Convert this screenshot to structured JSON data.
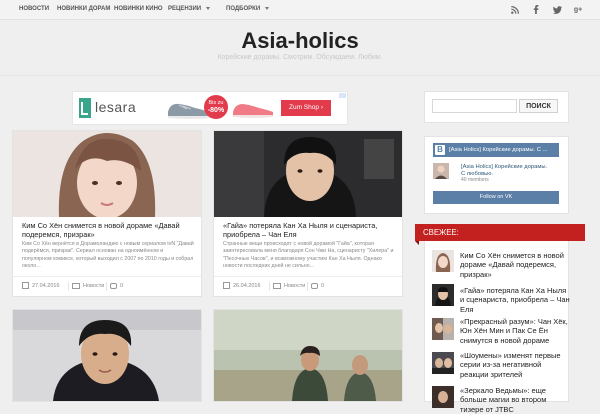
{
  "nav": {
    "items": [
      {
        "label": "Новости"
      },
      {
        "label": "Новинки дорам"
      },
      {
        "label": "Новинки кино"
      },
      {
        "label": "Рецензии"
      },
      {
        "label": "Подборки"
      }
    ],
    "social_icons": [
      "rss-icon",
      "facebook-icon",
      "twitter-icon",
      "google-plus-icon"
    ]
  },
  "header": {
    "title": "Asia-holics",
    "tagline": "Корейские дорамы. Смотрим. Обсуждаем. Любим."
  },
  "ad": {
    "brand": "lesara",
    "badge_line1": "Bis zu",
    "badge_line2": "-80%",
    "button": "Zum Shop",
    "button_arrow": "›"
  },
  "cards": [
    {
      "title": "Ким Со Хён снимется в новой дораме «Давай подеремся, призрак»",
      "excerpt": "Ким Со Хён вернётся в Дорамоландию с новым сериалом tvN \"Давай подерёмся, призрак\". Сериал основан на одноимённом и популярном комиксе, который выходил с 2007 по 2010 годы и собрал около...",
      "date": "27.04.2016",
      "category": "Новости",
      "comments": "0"
    },
    {
      "title": "«Гайа» потеряла Кан Ха Ныля и сценариста, приобрела – Чан Еля",
      "excerpt": "Странные вещи происходят с новой дорамой \"Гайа\", которая заинтересовала меня благодаря Сон Чжи На, сценаристу \"Хилера\" и \"Песочных Часов\", и возможному участию Кан Ха Ныля. Однако новости последних дней не сильно...",
      "date": "26.04.2016",
      "category": "Новости",
      "comments": "0"
    }
  ],
  "sidebar": {
    "search_placeholder": "",
    "search_button": "ПОИСК",
    "vk": {
      "logo": "В",
      "header": "[Asia Holics] Корейские дорамы. С ...",
      "name_line1": "[Asia Holics] Корейские дорамы.",
      "name_line2": "С любовью.",
      "members": "40 members",
      "follow": "Follow on VK"
    },
    "fresh_title": "СВЕЖЕЕ:",
    "fresh_items": [
      {
        "title": "Ким Со Хён снимется в новой дораме «Давай подеремся, призрак»"
      },
      {
        "title": "«Гайа» потеряла Кан Ха Ныля и сценариста, приобрела – Чан Еля"
      },
      {
        "title": "«Прекрасный разум»: Чан Хёк, Юн Хён Мин и Пак Се Ён снимутся в новой дораме"
      },
      {
        "title": "«Шоумены» изменят первые серии из-за негативной реакции зрителей"
      },
      {
        "title": "«Зеркало Ведьмы»: еще больше магии во втором тизере от JTBC"
      }
    ]
  },
  "colors": {
    "accent_red": "#c32020",
    "vk_blue": "#5b7fa6",
    "page_bg": "#efefef"
  }
}
